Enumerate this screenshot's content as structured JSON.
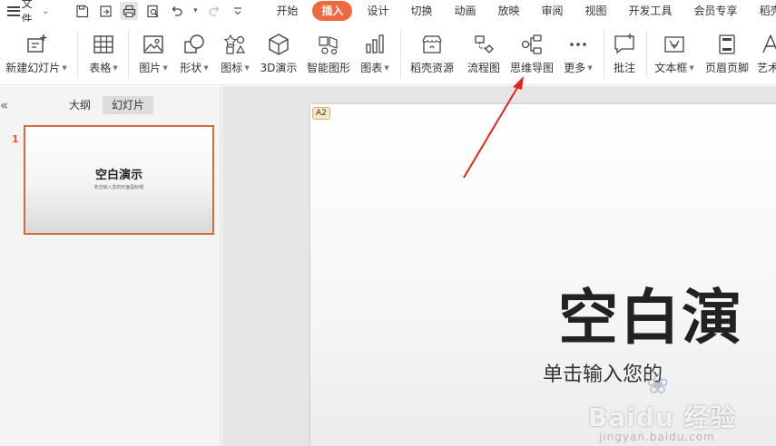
{
  "menubar": {
    "file_label": "文件",
    "tabs": [
      {
        "label": "开始",
        "active": false
      },
      {
        "label": "插入",
        "active": true
      },
      {
        "label": "设计",
        "active": false
      },
      {
        "label": "切换",
        "active": false
      },
      {
        "label": "动画",
        "active": false
      },
      {
        "label": "放映",
        "active": false
      },
      {
        "label": "审阅",
        "active": false
      },
      {
        "label": "视图",
        "active": false
      },
      {
        "label": "开发工具",
        "active": false
      },
      {
        "label": "会员专享",
        "active": false
      },
      {
        "label": "稻壳",
        "active": false
      }
    ],
    "accent_color": "#f0683e"
  },
  "ribbon": {
    "new_slide": "新建幻灯片",
    "table": "表格",
    "picture": "图片",
    "shape": "形状",
    "icon": "图标",
    "model3d": "3D演示",
    "smartart": "智能图形",
    "chart": "图表",
    "docer_resources": "稻壳资源",
    "flowchart": "流程图",
    "mindmap": "思维导图",
    "more": "更多",
    "comment": "批注",
    "textbox": "文本框",
    "header_footer": "页眉页脚",
    "wordart": "艺术"
  },
  "left_panel": {
    "tab_outline": "大纲",
    "tab_slides": "幻灯片",
    "slide_number": "1",
    "thumb_title": "空白演示",
    "thumb_subtitle": "单击输入您的封面副标题"
  },
  "slide": {
    "badge": "A2",
    "title": "空白演",
    "subtitle": "单击输入您的"
  },
  "watermark": {
    "brand": "Baidu 经验",
    "url": "jingyan.baidu.com"
  },
  "icons": [
    "menu-icon",
    "save-icon",
    "export-icon",
    "print-icon",
    "print-preview-icon",
    "undo-icon",
    "redo-icon",
    "customize-icon"
  ]
}
